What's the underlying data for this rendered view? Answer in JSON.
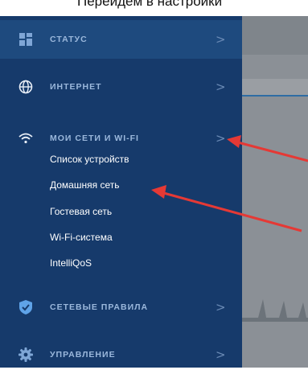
{
  "caption": "Перейдем в настройки",
  "sidebar": {
    "items": [
      {
        "label": "СТАТУС",
        "icon": "dashboard-icon"
      },
      {
        "label": "ИНТЕРНЕТ",
        "icon": "globe-icon"
      },
      {
        "label": "МОИ СЕТИ И WI-FI",
        "icon": "wifi-icon"
      },
      {
        "label": "СЕТЕВЫЕ ПРАВИЛА",
        "icon": "shield-icon"
      },
      {
        "label": "УПРАВЛЕНИЕ",
        "icon": "gear-icon"
      }
    ],
    "subitems": [
      "Список устройств",
      "Домашняя сеть",
      "Гостевая сеть",
      "Wi-Fi-система",
      "IntelliQoS"
    ],
    "chevron": ">"
  },
  "colors": {
    "sidebar_bg": "#163a6b",
    "active_bg": "#1e4a7e",
    "label_text": "#9bb8dc",
    "arrow": "#e53935"
  }
}
